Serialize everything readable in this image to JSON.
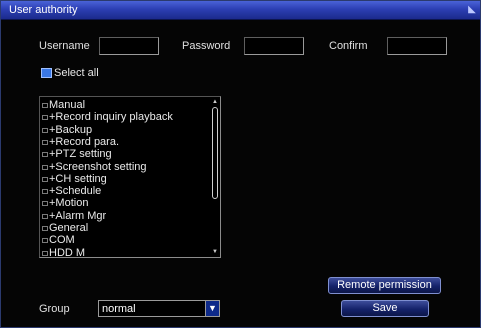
{
  "window": {
    "title": "User authority"
  },
  "credentials": {
    "username_label": "Username",
    "username_value": "",
    "password_label": "Password",
    "password_value": "",
    "confirm_label": "Confirm",
    "confirm_value": ""
  },
  "select_all": {
    "label": "Select all",
    "checked": true
  },
  "permissions": [
    {
      "label": "Manual"
    },
    {
      "label": "+Record  inquiry  playback"
    },
    {
      "label": "+Backup"
    },
    {
      "label": "+Record  para."
    },
    {
      "label": "+PTZ  setting"
    },
    {
      "label": "+Screenshot  setting"
    },
    {
      "label": "+CH  setting"
    },
    {
      "label": "+Schedule"
    },
    {
      "label": "+Motion"
    },
    {
      "label": "+Alarm  Mgr"
    },
    {
      "label": "General"
    },
    {
      "label": "COM"
    },
    {
      "label": "HDD  M"
    }
  ],
  "buttons": {
    "remote_permission": "Remote  permission",
    "save": "Save"
  },
  "group": {
    "label": "Group",
    "selected": "normal"
  },
  "colors": {
    "titlebar": "#2c3fb4",
    "checkbox_accent": "#3a78e6",
    "button": "#15226a"
  }
}
